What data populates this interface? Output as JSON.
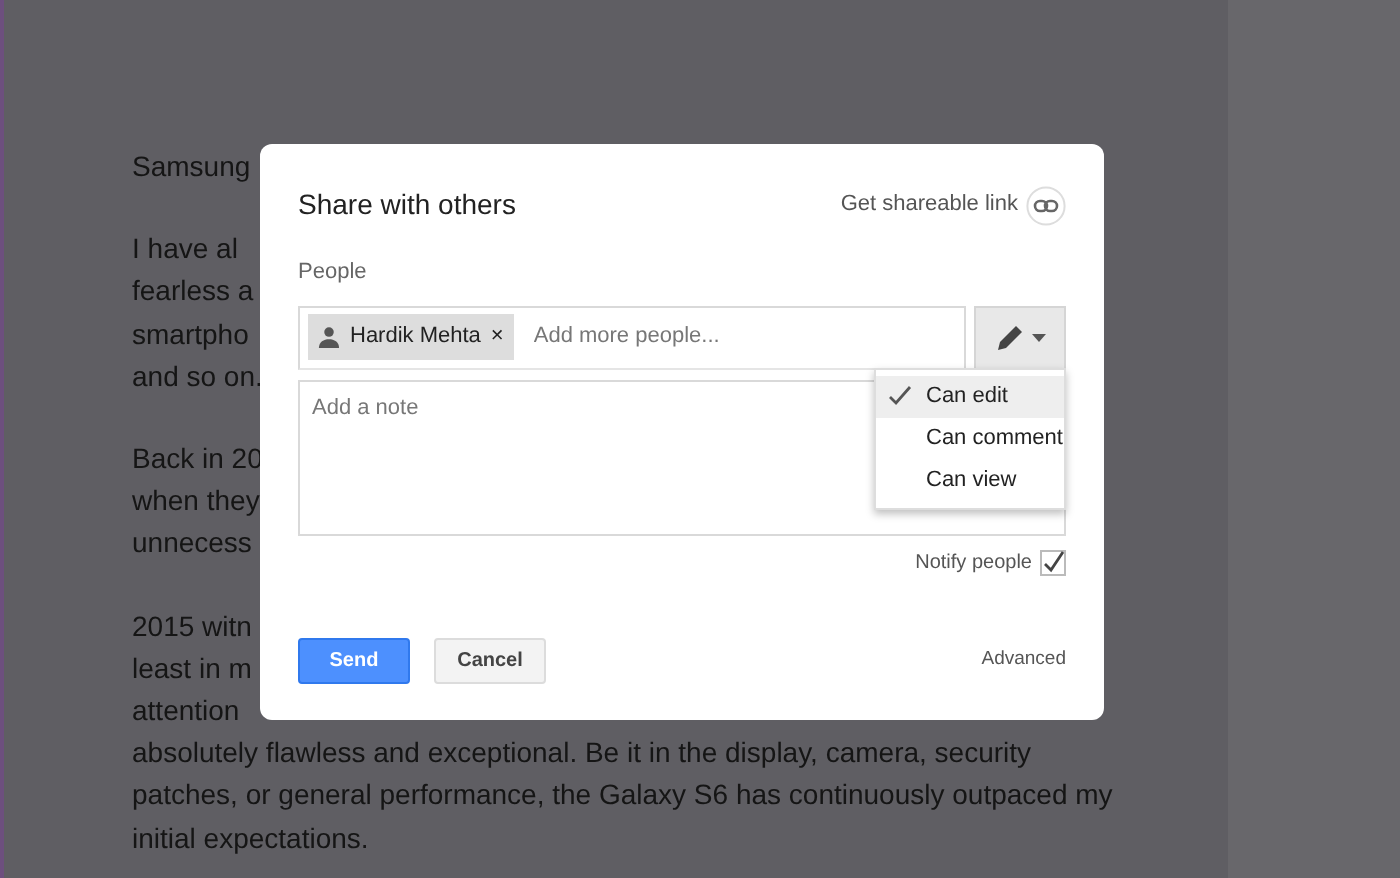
{
  "document": {
    "paragraphs": [
      [
        "Samsung"
      ],
      [
        "I have al",
        "fearless a",
        "smartpho",
        "and so on."
      ],
      [
        "Back in 20",
        "when they",
        "unnecess"
      ],
      [
        "2015 witn",
        "least in m",
        "attention",
        "absolutely flawless and exceptional. Be it in the display, camera, security",
        "patches, or general performance, the Galaxy S6 has continuously outpaced my",
        "initial expectations."
      ]
    ]
  },
  "dialog": {
    "title": "Share with others",
    "shareable_link": "Get shareable link",
    "people_label": "People",
    "chips": [
      {
        "name": "Hardik Mehta",
        "remove": "×"
      }
    ],
    "people_placeholder": "Add more people...",
    "note_placeholder": "Add a note",
    "permission_menu": [
      {
        "label": "Can edit",
        "selected": true
      },
      {
        "label": "Can comment",
        "selected": false
      },
      {
        "label": "Can view",
        "selected": false
      }
    ],
    "notify": {
      "label": "Notify people",
      "checked": true
    },
    "buttons": [
      {
        "label": "Send",
        "kind": "primary"
      },
      {
        "label": "Cancel",
        "kind": "secondary"
      }
    ],
    "advanced": "Advanced"
  }
}
